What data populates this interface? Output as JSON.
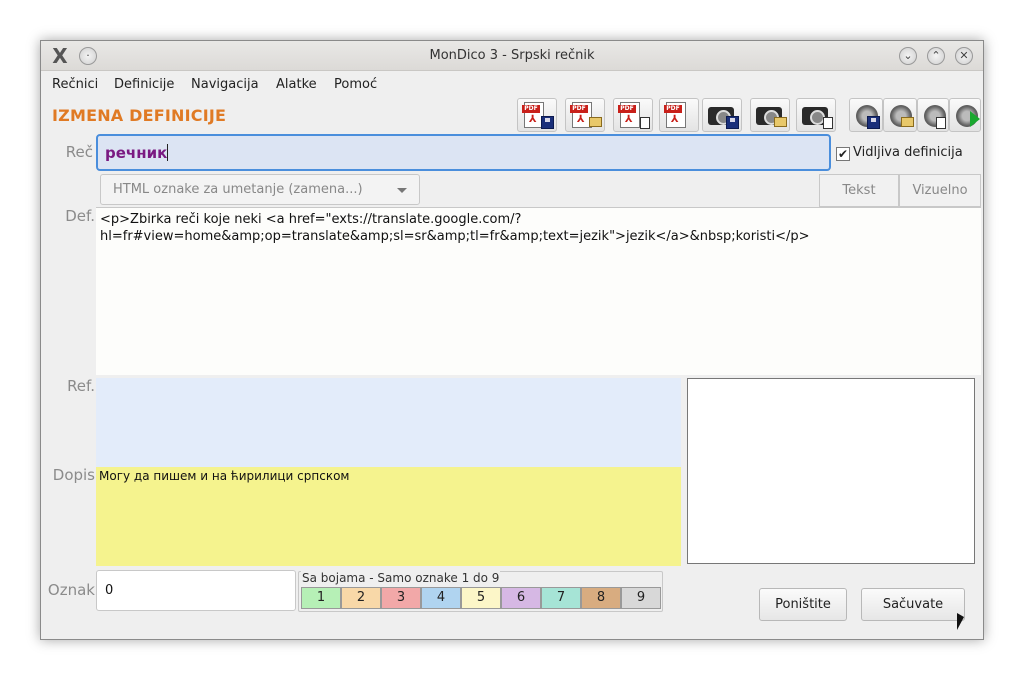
{
  "window": {
    "title": "MonDico 3 - Srpski rečnik"
  },
  "menu": {
    "items": [
      "Rečnici",
      "Definicije",
      "Navigacija",
      "Alatke",
      "Pomoć"
    ]
  },
  "editor": {
    "heading": "IZMENA DEFINICIJE",
    "word_label": "Reč",
    "word_value": "речник",
    "visible_definition_label": "Vidljiva definicija",
    "visible_definition_checked": true,
    "html_combo_placeholder": "HTML oznake za umetanje (zamena...)",
    "tab_text": "Tekst",
    "tab_visual": "Vizuelno",
    "def_label": "Def.",
    "def_value": "<p>Zbirka reči koje neki <a href=\"exts://translate.google.com/?\nhl=fr#view=home&amp;op=translate&amp;sl=sr&amp;tl=fr&amp;text=jezik\">jezik</a>&nbsp;koristi</p>",
    "ref_label": "Ref.",
    "ref_value": "",
    "dopis_label": "Dopis",
    "dopis_value": "Могу да пишем и на ћирилици српском",
    "oznak_label": "Oznak",
    "oznak_value": "0",
    "color_group_label": "Sa bojama - Samo oznake 1 do 9",
    "color_swatches": [
      {
        "label": "1",
        "color": "#b6f0b6"
      },
      {
        "label": "2",
        "color": "#f8d8a8"
      },
      {
        "label": "3",
        "color": "#f2a8a8"
      },
      {
        "label": "4",
        "color": "#b0d4f0"
      },
      {
        "label": "5",
        "color": "#fcf6c8"
      },
      {
        "label": "6",
        "color": "#d6b8e4"
      },
      {
        "label": "7",
        "color": "#a6e4d6"
      },
      {
        "label": "8",
        "color": "#d8ac80"
      },
      {
        "label": "9",
        "color": "#d8d8d8"
      }
    ],
    "cancel_label": "Poništite",
    "save_label": "Sačuvate"
  },
  "toolbar": {
    "icons": [
      "pdf-save-icon",
      "pdf-open-icon",
      "pdf-delete-icon",
      "pdf-icon",
      "camera-save-icon",
      "camera-open-icon",
      "camera-delete-icon",
      "sound-save-icon",
      "sound-open-icon",
      "sound-delete-icon",
      "sound-play-icon"
    ]
  },
  "colors": {
    "accent": "#e07a24",
    "word_text": "#7a1a82",
    "focus_border": "#4a8edc",
    "ref_bg": "#e3ecfa",
    "dopis_bg": "#f5f38e"
  }
}
